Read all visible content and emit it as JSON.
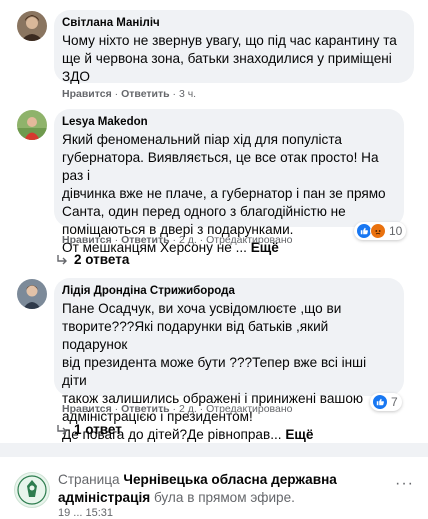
{
  "comments": [
    {
      "author": "Світлана Маніліч",
      "lines": [
        "Чому ніхто не звернув увагу, що під час карантину та",
        "ще й червона зона, батьки знаходилися у приміщені",
        "ЗДО"
      ],
      "like": "Нравится",
      "reply": "Ответить",
      "time": "3 ч."
    },
    {
      "author": "Lesya Makedon",
      "lines": [
        "Який феноменальний піар хід для популіста",
        "губернатора. Виявляється, це все отак просто! На раз і",
        "дівчинка вже не плаче, а губернатор і пан зе прямо",
        "Санта, один перед одного з благодійністю не",
        "поміщаються в двері з подарунками."
      ],
      "last_line": "От мешканцям Херсону не ...",
      "more": "Ещё",
      "like": "Нравится",
      "reply": "Ответить",
      "time": "2 д.",
      "edited": "Отредактировано",
      "reaction_count": "10",
      "replies_label": "2 ответа"
    },
    {
      "author": "Лідія Дрондіна Стрижиборода",
      "lines": [
        "Пане Осадчук, ви хоча усвідомлюєте ,що ви",
        "творите???Які подарунки від батьків ,який подарунок",
        "від президента може бути ???Тепер вже всі інші діти",
        "також залишились ображені і принижені вашою",
        "адміністрацією і президентом!"
      ],
      "last_line": "Де повага до дітей?Де рівноправ...",
      "more": "Ещё",
      "like": "Нравится",
      "reply": "Ответить",
      "time": "2 д.",
      "edited": "Отредактировано",
      "reaction_count": "7",
      "replies_label": "1 ответ"
    }
  ],
  "separator": "·",
  "page_post": {
    "prefix": "Страница",
    "page_name": "Чернівецька обласна державна адміністрація",
    "suffix": "була в прямом эфире.",
    "time_partial": "19 ...  15:31"
  },
  "colors": {
    "bubble": "#f0f2f5",
    "meta": "#65676b",
    "like_blue": "#1877f2"
  },
  "icons": [
    "like-reaction-icon",
    "angry-reaction-icon",
    "reply-arrow-icon",
    "more-options-icon"
  ]
}
